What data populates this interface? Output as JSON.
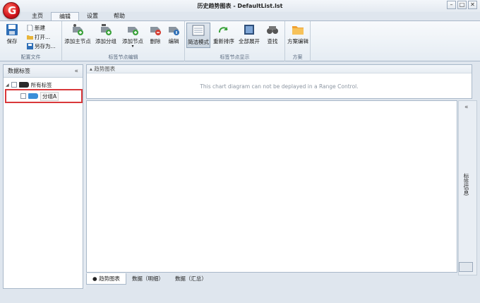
{
  "window": {
    "title": "历史趋势图表 - DefaultList.lst",
    "logo_letter": "G"
  },
  "window_buttons": {
    "minimize": "–",
    "maximize": "□",
    "close": "✕"
  },
  "tabs": [
    {
      "label": "主页",
      "active": false
    },
    {
      "label": "编辑",
      "active": true
    },
    {
      "label": "设置",
      "active": false
    },
    {
      "label": "帮助",
      "active": false
    }
  ],
  "ribbon": {
    "group_config": {
      "caption": "配置文件",
      "save": "保存",
      "new": "新建",
      "open": "打开...",
      "save_as": "另存为..."
    },
    "group_edit": {
      "caption": "标签节点编辑",
      "add_main": "添加主节点",
      "add_group": "添加分组",
      "add_node": "添加节点",
      "delete": "删除",
      "edit": "编辑"
    },
    "group_display": {
      "caption": "标签节点显示",
      "simple_mode": "简洁模式",
      "resort": "重新排序",
      "expand_all": "全部展开",
      "find": "查找"
    },
    "group_plan": {
      "caption": "方案",
      "plan_edit": "方案编辑"
    }
  },
  "left_panel": {
    "title": "数据标签",
    "collapse": "«",
    "tree": {
      "root": "所有标签",
      "child": "分组A"
    }
  },
  "range_panel": {
    "title": "趋势图表",
    "message": "This chart diagram can not be deplayed in a Range Control."
  },
  "right_panel": {
    "expand": "«",
    "label": "标签信息"
  },
  "bottom_tabs": [
    {
      "label": "趋势图表",
      "active": true
    },
    {
      "label": "数据（明细）",
      "active": false
    },
    {
      "label": "数据（汇总）",
      "active": false
    }
  ],
  "colors": {
    "accent": "#d9383a",
    "chrome": "#dfe6ee",
    "border": "#a9b8c9"
  }
}
